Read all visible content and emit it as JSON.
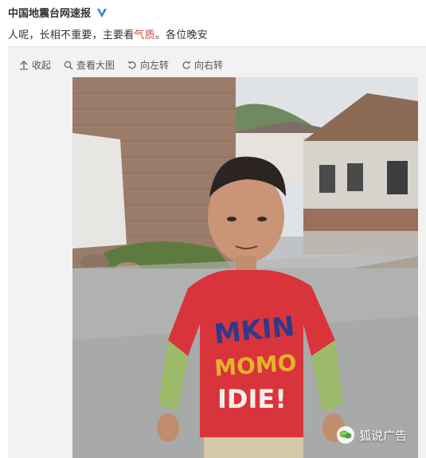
{
  "post": {
    "username": "中国地震台网速报",
    "verified_icon": "verified-v-icon",
    "text_before": "人呢，长相不重要，主要看",
    "text_highlight": "气质",
    "text_after": "。各位晚安",
    "highlight_color": "#d0453a"
  },
  "toolbar": {
    "items": [
      {
        "icon": "collapse-icon",
        "label": "收起"
      },
      {
        "icon": "zoom-icon",
        "label": "查看大图"
      },
      {
        "icon": "rotate-left-icon",
        "label": "向左转"
      },
      {
        "icon": "rotate-right-icon",
        "label": "向右转"
      }
    ]
  },
  "photo": {
    "watermark_text": "狐说广告",
    "watermark_icon": "wechat-icon"
  },
  "colors": {
    "accent": "#1e88e5",
    "card_bg": "#f2f2f2",
    "text": "#333333"
  }
}
